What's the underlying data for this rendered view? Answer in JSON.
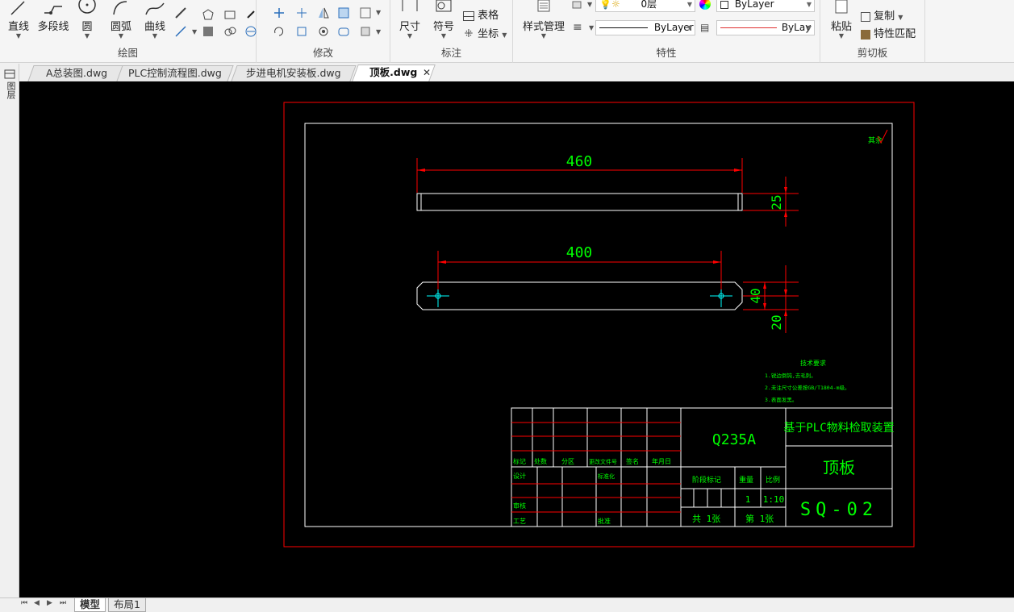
{
  "ribbon": {
    "draw": {
      "group_label": "绘图",
      "buttons": [
        "直线",
        "多段线",
        "圆",
        "圆弧",
        "曲线"
      ]
    },
    "modify": {
      "group_label": "修改"
    },
    "annotate": {
      "group_label": "标注",
      "dimension": "尺寸",
      "symbol": "符号",
      "table": "表格",
      "coordinate": "坐标"
    },
    "properties": {
      "group_label": "特性",
      "style_manager": "样式管理",
      "layer": "0层",
      "color": "ByLayer",
      "linetype": "ByLayer",
      "lineweight": "ByLay"
    },
    "clipboard": {
      "group_label": "剪切板",
      "paste": "粘贴",
      "copy": "复制",
      "match_props": "特性匹配"
    }
  },
  "file_tabs": [
    "A总装图.dwg",
    "PLC控制流程图.dwg",
    "步进电机安装板.dwg",
    "顶板.dwg"
  ],
  "active_tab_index": 3,
  "left_toolbar": {
    "label": "图层"
  },
  "drawing": {
    "dim_top_length": "460",
    "dim_top_height": "25",
    "dim_bottom_length": "400",
    "dim_bottom_height": "40",
    "dim_bottom_offset": "20",
    "roughness_mark": "其余",
    "tech_req_title": "技术要求",
    "tech_req_lines": [
      "1.锐边倒钝,去毛刺。",
      "2.未注尺寸公差按GB/T1804-m级。",
      "3.表面发黑。"
    ],
    "title_block": {
      "material": "Q235A",
      "project": "基于PLC物料检取装置",
      "part_name": "顶板",
      "drawing_no": "SQ-02",
      "rev_headers": [
        "标记",
        "处数",
        "分区",
        "更改文件号",
        "签名",
        "年月日"
      ],
      "row_design": "设计",
      "row_standard": "标准化",
      "row_review": "审核",
      "row_process": "工艺",
      "row_approve": "批准",
      "stage_mark": "阶段标记",
      "weight": "重量",
      "scale": "比例",
      "qty": "1",
      "scale_value": "1:10",
      "sheets_total": "共 1张",
      "sheet_no": "第 1张"
    }
  },
  "layout_tabs": [
    "模型",
    "布局1"
  ],
  "active_layout": 0,
  "colors": {
    "green": "#00ff00",
    "red": "#ff0000",
    "white": "#ffffff",
    "cyan": "#00ffff",
    "canvas": "#000000"
  }
}
